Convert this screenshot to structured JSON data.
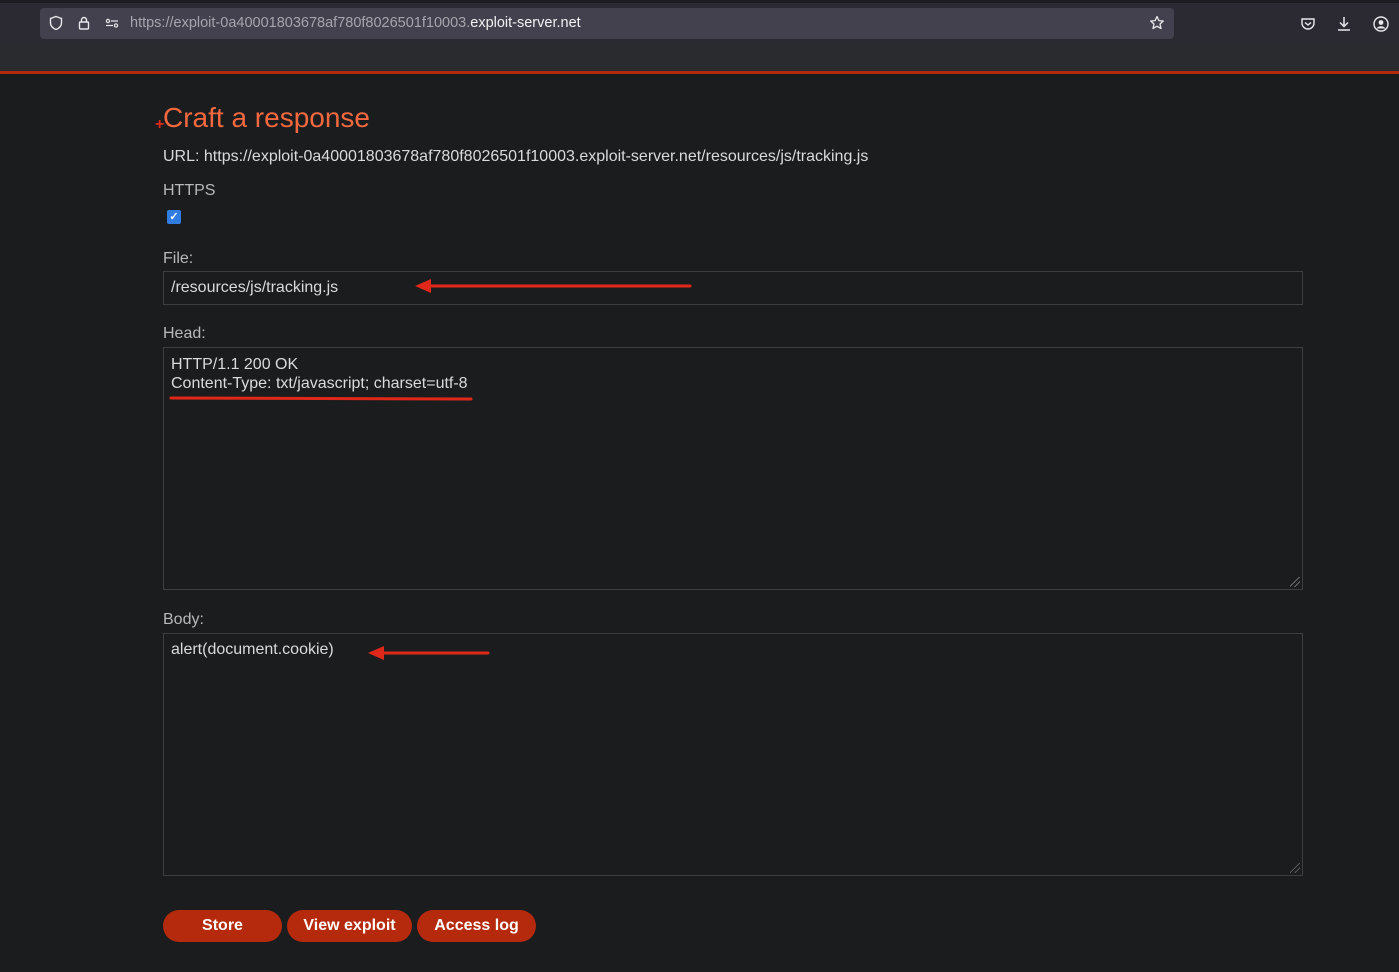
{
  "browser": {
    "url_prefix": "https://exploit-0a40001803678af780f8026501f10003.",
    "url_host": "exploit-server.net"
  },
  "page": {
    "title": "Craft a response",
    "url_line": "URL: https://exploit-0a40001803678af780f8026501f10003.exploit-server.net/resources/js/tracking.js",
    "https_label": "HTTPS",
    "https_checked": true,
    "file_label": "File:",
    "file_value": "/resources/js/tracking.js",
    "head_label": "Head:",
    "head_value": "HTTP/1.1 200 OK\nContent-Type: txt/javascript; charset=utf-8",
    "body_label": "Body:",
    "body_value": "alert(document.cookie)"
  },
  "buttons": {
    "store": "Store",
    "view_exploit": "View exploit",
    "access_log": "Access log"
  },
  "colors": {
    "accent": "#b52a0c",
    "title": "#f2683f",
    "annotation": "#e0281a"
  }
}
